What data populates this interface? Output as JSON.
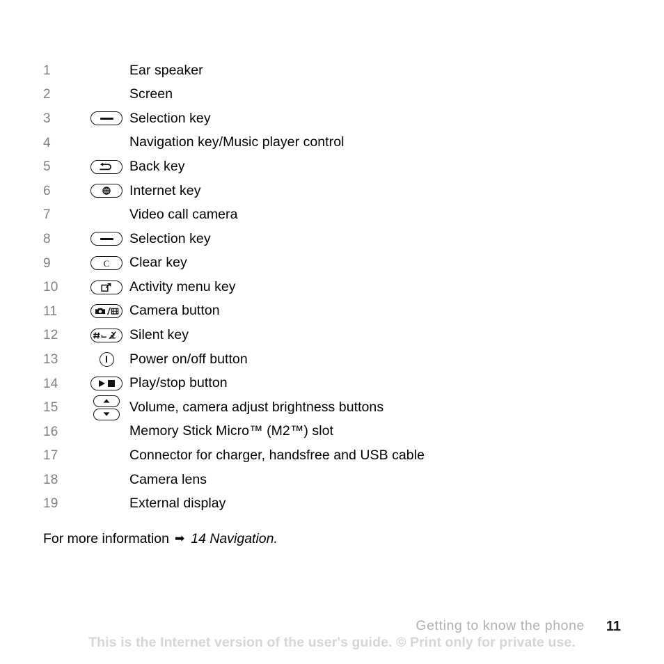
{
  "page": {
    "chapter_footer": "Getting to know the phone",
    "page_number": "11",
    "watermark": "This is the Internet version of the user's guide. © Print only for private use."
  },
  "more_information": {
    "lead_text": "For more information",
    "arrow_icon": "right-arrow-icon",
    "arrow_glyph": "➡",
    "reference": "14 Navigation."
  },
  "colors": {
    "number": "#808080",
    "label": "#000000",
    "icon_stroke": "#111111",
    "footer_chapter": "#b0b0b0",
    "footer_page": "#1b1b1b",
    "watermark": "#d6d6d6"
  },
  "legend": {
    "rows": [
      {
        "num": "1",
        "icon": "none",
        "label": "Ear speaker"
      },
      {
        "num": "2",
        "icon": "none",
        "label": "Screen"
      },
      {
        "num": "3",
        "icon": "selection-key-icon",
        "label": "Selection key"
      },
      {
        "num": "4",
        "icon": "none",
        "label": "Navigation key/Music player control"
      },
      {
        "num": "5",
        "icon": "back-key-icon",
        "label": "Back key"
      },
      {
        "num": "6",
        "icon": "internet-key-icon",
        "label": "Internet key"
      },
      {
        "num": "7",
        "icon": "none",
        "label": "Video call camera"
      },
      {
        "num": "8",
        "icon": "selection-key-icon",
        "label": "Selection key"
      },
      {
        "num": "9",
        "icon": "clear-key-icon",
        "label": "Clear key"
      },
      {
        "num": "10",
        "icon": "activity-menu-key-icon",
        "label": "Activity menu key"
      },
      {
        "num": "11",
        "icon": "camera-button-icon",
        "label": "Camera button"
      },
      {
        "num": "12",
        "icon": "silent-key-icon",
        "label": "Silent key"
      },
      {
        "num": "13",
        "icon": "power-button-icon",
        "label": "Power on/off button"
      },
      {
        "num": "14",
        "icon": "play-stop-button-icon",
        "label": "Play/stop button"
      },
      {
        "num": "15",
        "icon": "volume-buttons-icon",
        "label": "Volume, camera adjust brightness buttons"
      },
      {
        "num": "16",
        "icon": "none",
        "label": "Memory Stick Micro™ (M2™) slot"
      },
      {
        "num": "17",
        "icon": "none",
        "label": "Connector for charger, handsfree and USB cable"
      },
      {
        "num": "18",
        "icon": "none",
        "label": "Camera lens"
      },
      {
        "num": "19",
        "icon": "none",
        "label": "External display"
      }
    ]
  },
  "icon_labels": {
    "clear_key_glyph": "C",
    "silent_key_glyph": "#"
  }
}
